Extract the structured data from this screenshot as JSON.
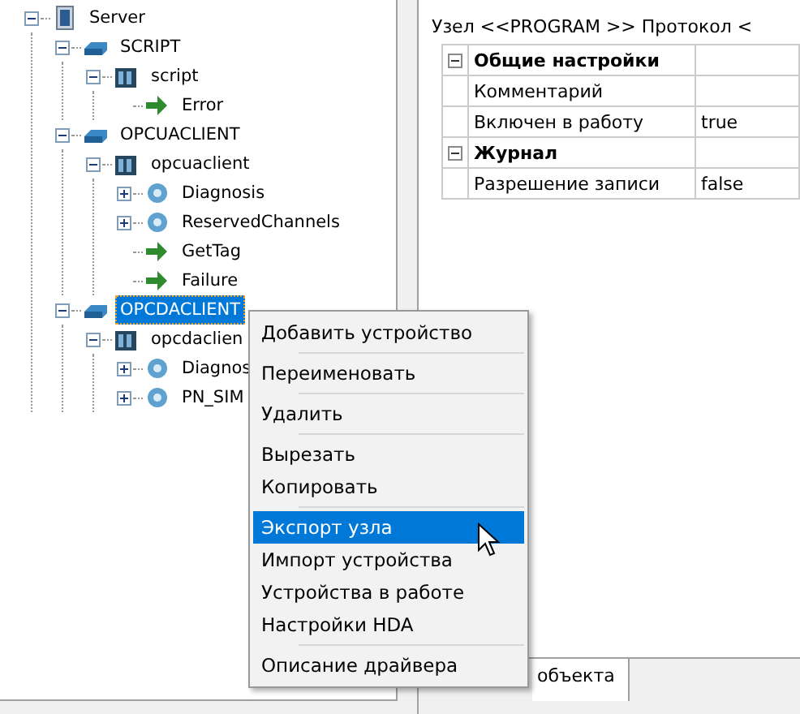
{
  "tree": [
    {
      "label": "Server",
      "kind": "server",
      "expanded": true,
      "selected": false,
      "children": [
        {
          "label": "SCRIPT",
          "kind": "driver",
          "expanded": true,
          "selected": false,
          "children": [
            {
              "label": "script",
              "kind": "device",
              "expanded": true,
              "selected": false,
              "children": [
                {
                  "label": "Error",
                  "kind": "tag",
                  "selected": false
                }
              ]
            }
          ]
        },
        {
          "label": "OPCUACLIENT",
          "kind": "driver",
          "expanded": true,
          "selected": false,
          "children": [
            {
              "label": "opcuaclient",
              "kind": "device",
              "expanded": true,
              "selected": false,
              "children": [
                {
                  "label": "Diagnosis",
                  "kind": "group",
                  "expanded": false,
                  "selected": false
                },
                {
                  "label": "ReservedChannels",
                  "kind": "group",
                  "expanded": false,
                  "selected": false
                },
                {
                  "label": "GetTag",
                  "kind": "tag",
                  "selected": false
                },
                {
                  "label": "Failure",
                  "kind": "tag",
                  "selected": false
                }
              ]
            }
          ]
        },
        {
          "label": "OPCDACLIENT",
          "kind": "driver",
          "expanded": true,
          "selected": true,
          "children": [
            {
              "label": "opcdaclien",
              "kind": "device",
              "expanded": true,
              "selected": false,
              "children": [
                {
                  "label": "Diagnos",
                  "kind": "group",
                  "expanded": false,
                  "selected": false
                },
                {
                  "label": "PN_SIM",
                  "kind": "group",
                  "expanded": false,
                  "selected": false
                }
              ]
            }
          ]
        }
      ]
    }
  ],
  "header": "Узел <<PROGRAM  >> Протокол <",
  "properties": [
    {
      "kind": "category",
      "name": "Общие настройки",
      "expanded": true
    },
    {
      "kind": "property",
      "name": "Комментарий"
    },
    {
      "kind": "property",
      "name": "Включен в работу",
      "value": "true"
    },
    {
      "kind": "category",
      "name": "Журнал",
      "expanded": true
    },
    {
      "kind": "property",
      "name": "Разрешение записи",
      "value": "false"
    }
  ],
  "bottom_tab": "объекта",
  "context_menu": [
    {
      "kind": "item",
      "label": "Добавить устройство",
      "selected": false
    },
    {
      "kind": "separator"
    },
    {
      "kind": "item",
      "label": "Переименовать",
      "selected": false
    },
    {
      "kind": "separator"
    },
    {
      "kind": "item",
      "label": "Удалить",
      "selected": false
    },
    {
      "kind": "separator"
    },
    {
      "kind": "item",
      "label": "Вырезать",
      "selected": false
    },
    {
      "kind": "item",
      "label": "Копировать",
      "selected": false
    },
    {
      "kind": "separator"
    },
    {
      "kind": "item",
      "label": "Экспорт узла",
      "selected": true
    },
    {
      "kind": "item",
      "label": "Импорт устройства",
      "selected": false
    },
    {
      "kind": "item",
      "label": "Устройства в работе",
      "selected": false
    },
    {
      "kind": "item",
      "label": "Настройки HDA",
      "selected": false
    },
    {
      "kind": "separator"
    },
    {
      "kind": "item",
      "label": "Описание драйвера",
      "selected": false
    }
  ]
}
